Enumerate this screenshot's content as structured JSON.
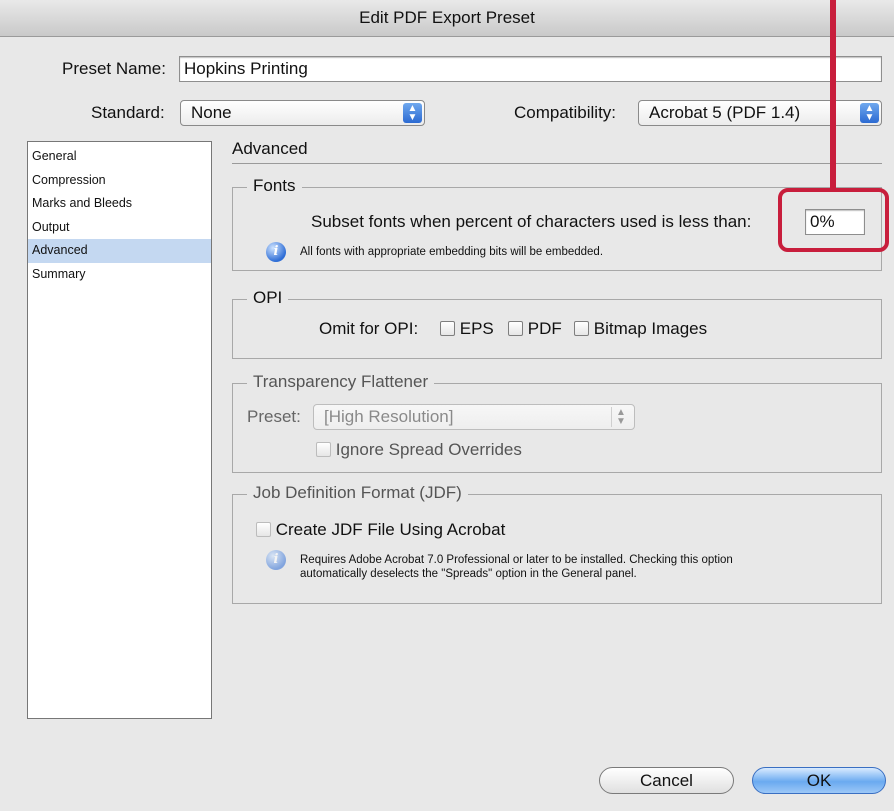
{
  "window": {
    "title": "Edit PDF Export Preset"
  },
  "preset_name": {
    "label": "Preset Name:",
    "value": "Hopkins Printing"
  },
  "standard": {
    "label": "Standard:",
    "value": "None"
  },
  "compatibility": {
    "label": "Compatibility:",
    "value": "Acrobat 5 (PDF 1.4)"
  },
  "sidebar": {
    "items": [
      {
        "label": "General"
      },
      {
        "label": "Compression"
      },
      {
        "label": "Marks and Bleeds"
      },
      {
        "label": "Output"
      },
      {
        "label": "Advanced",
        "selected": true
      },
      {
        "label": "Summary"
      }
    ]
  },
  "panel": {
    "title": "Advanced",
    "fonts": {
      "legend": "Fonts",
      "subset_label": "Subset fonts when percent of characters used is less than:",
      "subset_value": "0%",
      "note": "All fonts with appropriate embedding bits will be embedded."
    },
    "opi": {
      "legend": "OPI",
      "omit_label": "Omit for OPI:",
      "eps": "EPS",
      "pdf": "PDF",
      "bitmap": "Bitmap Images"
    },
    "transparency": {
      "legend": "Transparency Flattener",
      "preset_label": "Preset:",
      "preset_value": "[High Resolution]",
      "ignore_label": "Ignore Spread Overrides"
    },
    "jdf": {
      "legend": "Job Definition Format (JDF)",
      "create_label": "Create JDF File Using Acrobat",
      "note_line1": "Requires Adobe Acrobat 7.0 Professional or later to be installed. Checking this option",
      "note_line2": "automatically deselects the \"Spreads\" option in the General panel."
    }
  },
  "buttons": {
    "cancel": "Cancel",
    "ok": "OK"
  },
  "colors": {
    "callout": "#c81e3c",
    "selection": "#c4d8f1",
    "accent": "#2c6ad2"
  },
  "icons": {
    "info": "info-icon",
    "popup_arrows": "popup-arrows-icon"
  }
}
